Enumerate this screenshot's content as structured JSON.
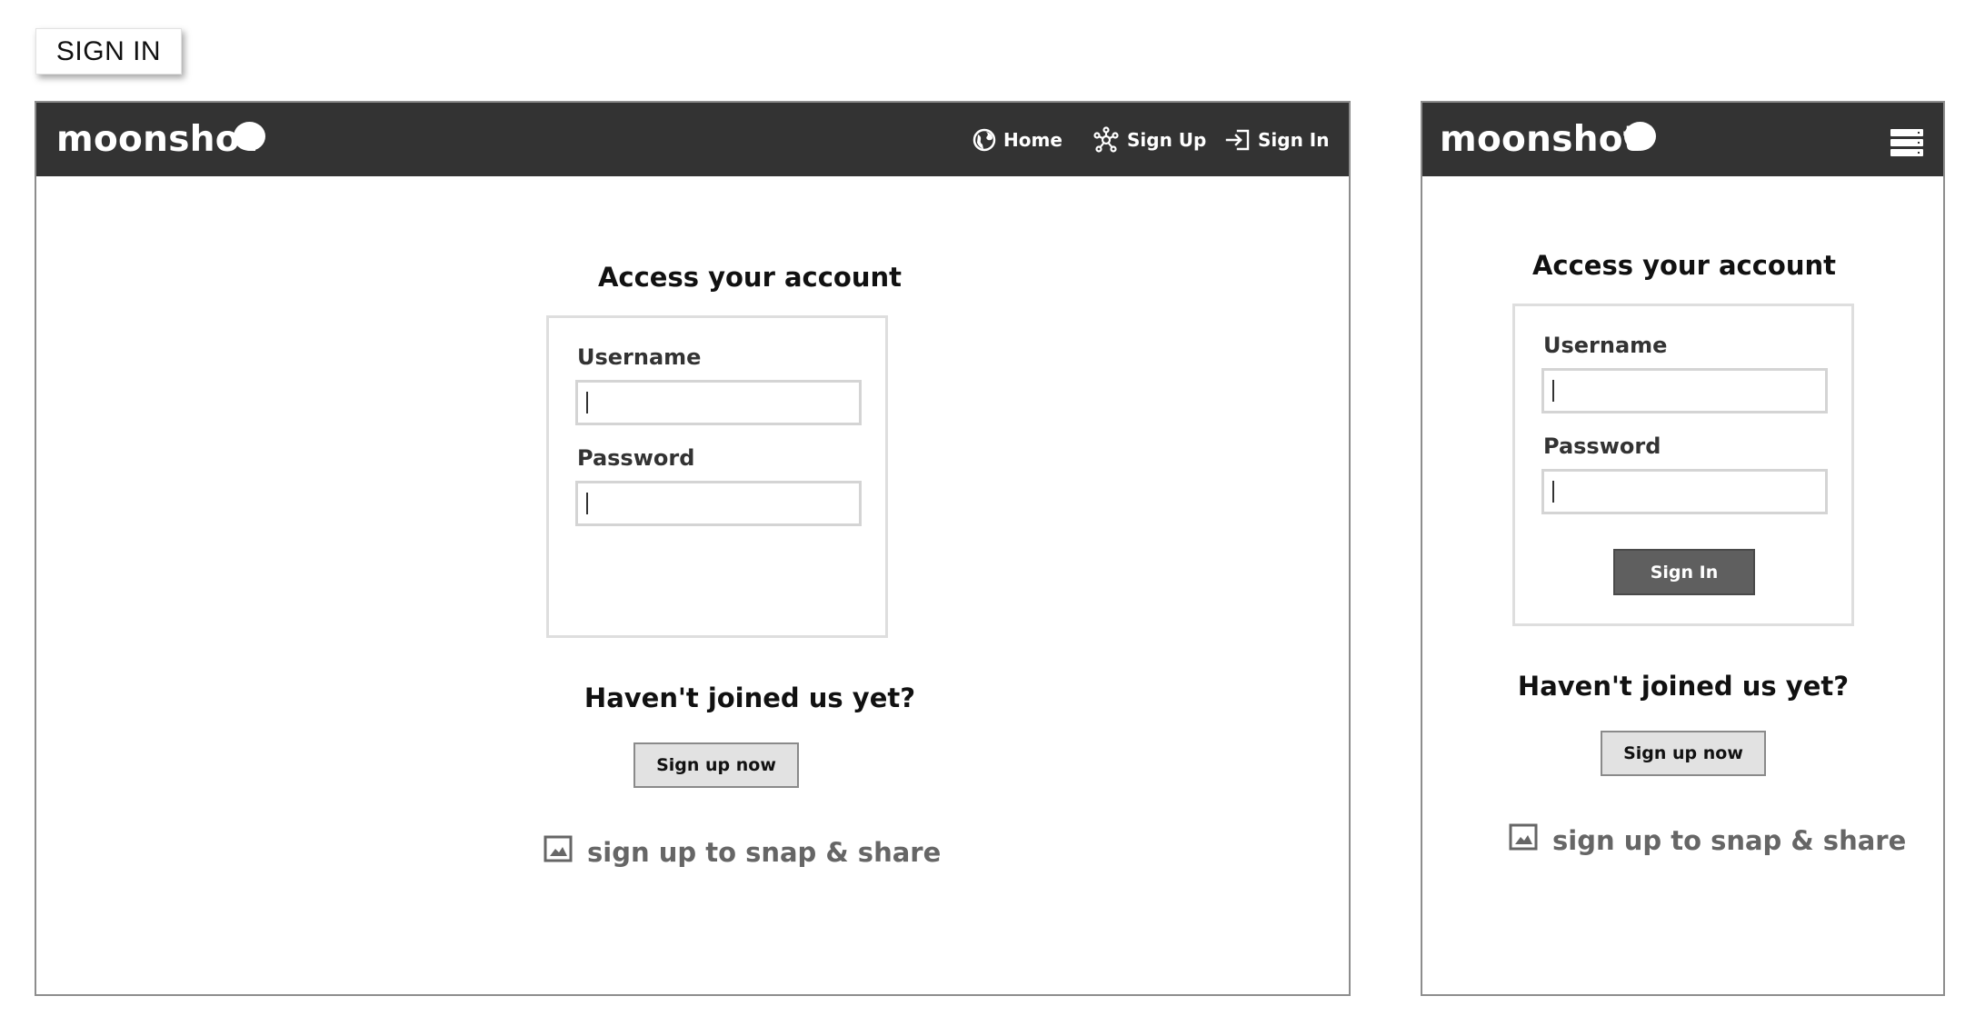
{
  "page_label": "SIGN IN",
  "brand": {
    "name": "moonshot"
  },
  "nav": {
    "home": "Home",
    "signup": "Sign Up",
    "signin": "Sign In"
  },
  "signin_form": {
    "title": "Access your account",
    "username_label": "Username",
    "username_value": "",
    "password_label": "Password",
    "password_value": "",
    "submit_label": "Sign In"
  },
  "join": {
    "title": "Haven't joined us yet?",
    "button_label": "Sign up now",
    "snap_link": "sign up to snap & share"
  },
  "colors": {
    "topbar": "#333333",
    "button_dark": "#5f5f5f",
    "button_light": "#e2e2e2",
    "muted_text": "#666666"
  },
  "icons": {
    "home": "globe-icon",
    "signup": "network-icon",
    "signin": "sign-in-arrow-icon",
    "menu": "hamburger-menu-icon",
    "snap": "image-icon"
  }
}
